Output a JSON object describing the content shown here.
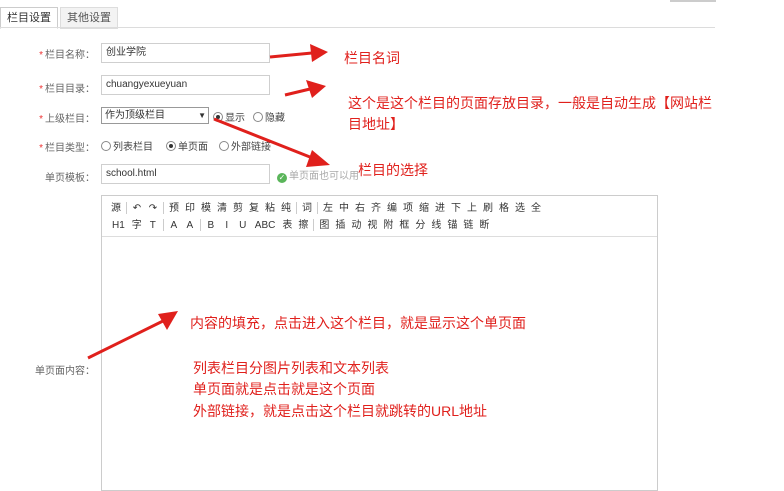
{
  "tabs": {
    "active": "栏目设置",
    "other": "其他设置"
  },
  "form": {
    "name_label": "栏目名称：",
    "name_value": "创业学院",
    "dir_label": "栏目目录：",
    "dir_value": "chuangyexueyuan",
    "parent_label": "上级栏目：",
    "parent_value": "作为顶级栏目",
    "show_label": "显示",
    "hide_label": "隐藏",
    "type_label": "栏目类型：",
    "type_list": "列表栏目",
    "type_single": "单页面",
    "type_external": "外部链接",
    "template_label": "单页模板：",
    "template_value": "school.html",
    "template_hint": "单页面也可以用",
    "content_label": "单页面内容："
  },
  "annotations": {
    "a1": "栏目名词",
    "a2_line1": "这个是这个栏目的页面存放目录，一般是自动生成【网站栏",
    "a2_line2": "目地址】",
    "a3": "栏目的选择",
    "a4": "内容的填充，点击进入这个栏目，就是显示这个单页面",
    "a5_line1": "列表栏目分图片列表和文本列表",
    "a5_line2": "单页面就是点击就是这个页面",
    "a5_line3": "外部链接，就是点击这个栏目就跳转的URL地址"
  },
  "toolbar": {
    "row1": [
      "源",
      "↶",
      "↷",
      "预",
      "印",
      "模",
      "清",
      "剪",
      "复",
      "粘",
      "纯",
      "词",
      "左",
      "中",
      "右",
      "齐",
      "编",
      "项",
      "缩",
      "进",
      "下",
      "上",
      "刷",
      "格",
      "选",
      "全"
    ],
    "row2": [
      "H1",
      "字",
      "T",
      "A",
      "A",
      "B",
      "I",
      "U",
      "ABC",
      "表",
      "擦",
      "图",
      "插",
      "动",
      "视",
      "附",
      "框",
      "分",
      "线",
      "锚",
      "链",
      "断"
    ]
  },
  "colors": {
    "accent": "#e0201c",
    "required": "#ee3333",
    "border": "#cccccc"
  }
}
